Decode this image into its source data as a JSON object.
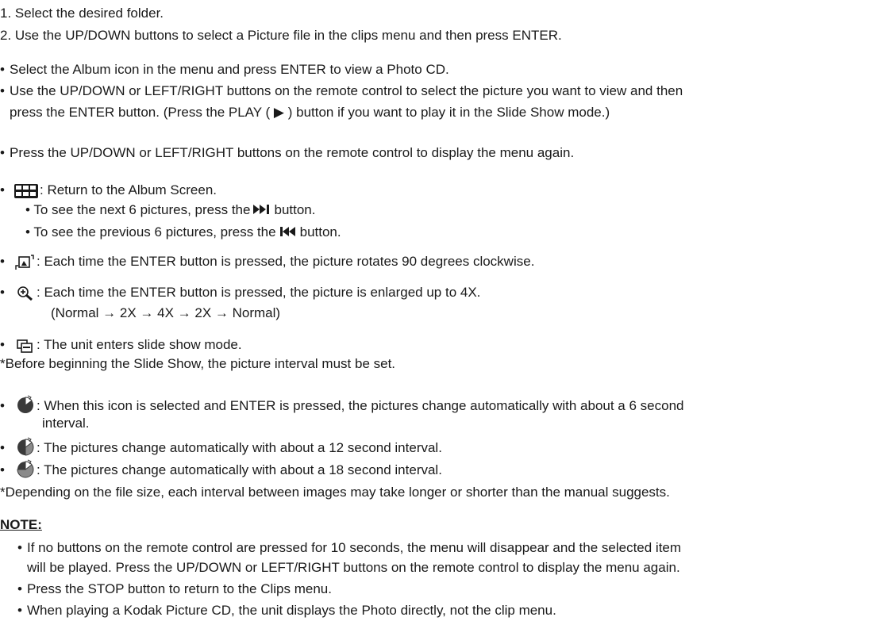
{
  "steps": [
    "1. Select the desired folder.",
    "2. Use the UP/DOWN buttons to select a Picture file in the clips menu and then press ENTER."
  ],
  "bullets_a": [
    "Select the Album icon in the menu and press ENTER to view a Photo CD.",
    "Use the UP/DOWN or LEFT/RIGHT buttons on the remote control to select the picture you want to view and then",
    "press the ENTER button. (Press the PLAY (",
    ") button if you want to play it in the Slide Show mode.)",
    "Press the UP/DOWN or LEFT/RIGHT buttons on the remote control to display the menu again."
  ],
  "album": {
    "label": ": Return to the Album Screen.",
    "next_a": "To see the next 6 pictures, press the",
    "next_b": "button.",
    "prev_a": "To see the previous 6 pictures, press the",
    "prev_b": "button."
  },
  "rotate": ": Each time the ENTER button is pressed, the picture rotates 90 degrees clockwise.",
  "zoom": {
    "line1": ": Each time the ENTER button is pressed, the picture is enlarged up to 4X.",
    "line2": "(Normal → 2X → 4X → 2X → Normal)"
  },
  "slideshow": {
    "label": ": The unit enters slide show mode.",
    "note": "*Before beginning the Slide Show, the picture interval must be set."
  },
  "intervals": {
    "six_a": ": When this icon is selected and ENTER is pressed, the pictures change automatically with about a 6 second",
    "six_b": "interval.",
    "twelve": ": The pictures change automatically with about a 12 second interval.",
    "eighteen": ": The pictures change automatically with about a 18 second interval."
  },
  "depending": "*Depending on the file size, each interval between images may take longer or shorter than the manual suggests.",
  "note": {
    "title": "NOTE:",
    "items": [
      "If no buttons on the remote control are pressed for 10 seconds, the menu will disappear and the selected item",
      "will be played. Press the UP/DOWN or LEFT/RIGHT buttons on the remote control to display the menu again.",
      "Press the STOP button to return to the Clips menu.",
      "When playing a Kodak Picture CD, the unit displays the Photo directly, not the clip menu."
    ]
  },
  "icons": {
    "bullet": "•",
    "play": "▶",
    "album": "album-grid-icon",
    "rotate": "rotate-icon",
    "zoom": "zoom-icon",
    "slideshow": "slideshow-icon",
    "next": "skip-next-icon",
    "prev": "skip-previous-icon"
  }
}
